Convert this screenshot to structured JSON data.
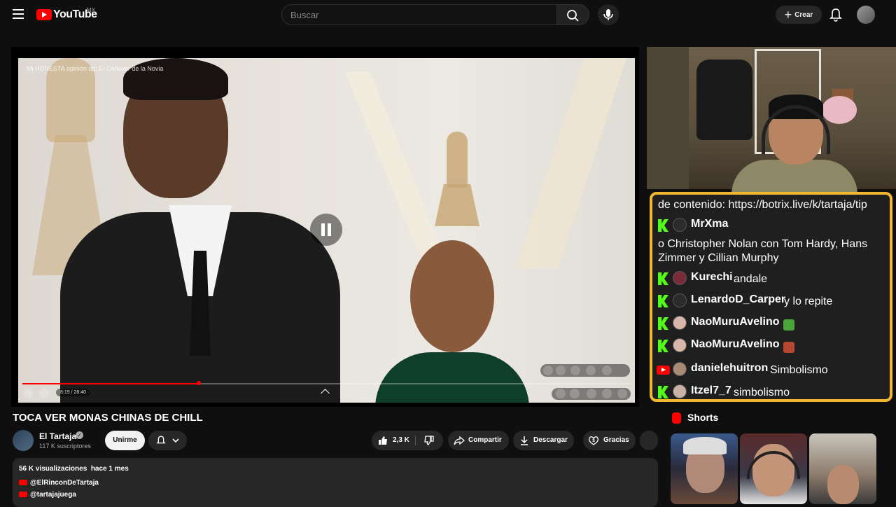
{
  "header": {
    "logo_text": "YouTube",
    "country_code": "MX",
    "search_placeholder": "Buscar",
    "create_label": "Crear"
  },
  "player": {
    "overlay_title": "Mi HONESTA opinión de: El Cadáver de la Novia",
    "time_display": "8:19 / 28:40",
    "progress_fraction": 0.29,
    "state": "playing"
  },
  "video": {
    "title": "TOCA VER MONAS CHINAS DE CHILL",
    "channel_name": "El Tartaja",
    "subscribers": "117 K suscriptores",
    "join_label": "Unirme",
    "likes": "2,3 K",
    "share_label": "Compartir",
    "download_label": "Descargar",
    "thanks_label": "Gracias"
  },
  "description": {
    "meta": "56 K visualizaciones  hace 1 mes",
    "links": [
      "@ElRinconDeTartaja",
      "@tartajajuega"
    ]
  },
  "chat": {
    "top_line": "de contenido: https://botrix.live/k/tartaja/tip",
    "wrapped_line_1": "o Christopher Nolan con Tom Hardy, Hans",
    "wrapped_line_2": "Zimmer y Cillian Murphy",
    "messages": [
      {
        "platform": "kick",
        "user": "MrXma",
        "text": ""
      },
      {
        "platform": "kick",
        "user": "Kurechi",
        "text": "andale"
      },
      {
        "platform": "kick",
        "user": "LenardoD_Carper",
        "text": "y lo repite"
      },
      {
        "platform": "kick",
        "user": "NaoMuruAvelino",
        "text": "",
        "emote": "green-frog-emote"
      },
      {
        "platform": "kick",
        "user": "NaoMuruAvelino",
        "text": "",
        "emote": "red-face-emote"
      },
      {
        "platform": "youtube",
        "user": "danielehuitron",
        "text": "Simbolismo"
      },
      {
        "platform": "kick",
        "user": "Itzel7_7",
        "text": "simbolismo"
      }
    ],
    "border_color": "#f1b730",
    "kick_color": "#53fc18"
  },
  "shorts": {
    "heading": "Shorts"
  },
  "colors": {
    "accent": "#ff0000",
    "background": "#0f0f0f"
  }
}
